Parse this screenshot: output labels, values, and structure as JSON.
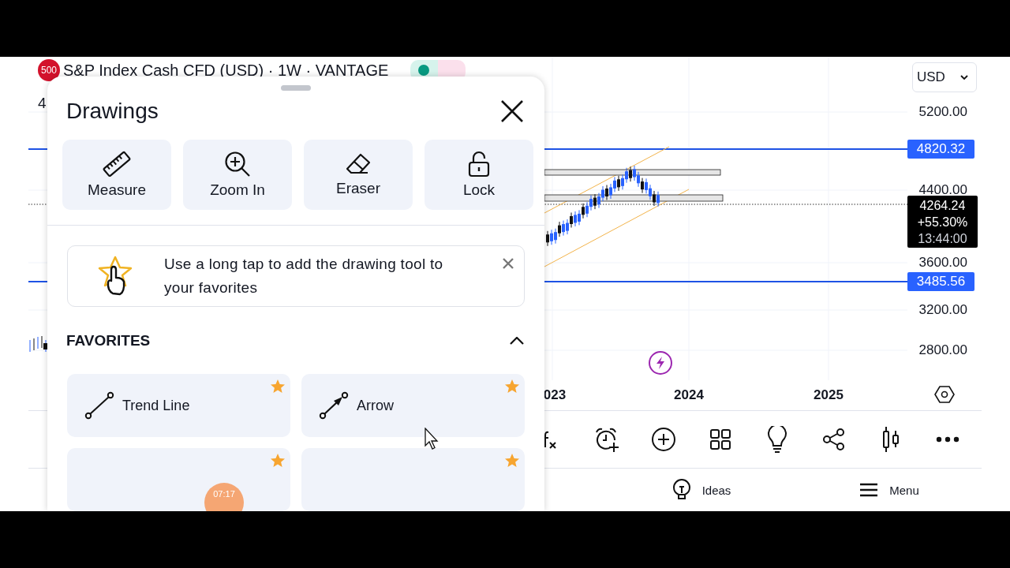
{
  "symbol": {
    "badge": "500",
    "title": "S&P Index Cash CFD (USD) · 1W · VANTAGE",
    "value_fragment": "4"
  },
  "currency_select": {
    "value": "USD"
  },
  "price_axis": {
    "ticks": [
      "5200.00",
      "4400.00",
      "3600.00",
      "3200.00",
      "2800.00"
    ]
  },
  "price_levels": [
    {
      "value": "4820.32"
    },
    {
      "value": "3485.56"
    }
  ],
  "last_price": {
    "price": "4264.24",
    "change": "+55.30%",
    "countdown": "13:44:00"
  },
  "time_axis": [
    "023",
    "2024",
    "2025"
  ],
  "bottom_nav": [
    {
      "kind": "ideas",
      "label": "Ideas"
    },
    {
      "kind": "menu",
      "label": "Menu"
    }
  ],
  "drawings_sheet": {
    "title": "Drawings",
    "tools": [
      {
        "kind": "measure",
        "label": "Measure"
      },
      {
        "kind": "zoom",
        "label": "Zoom In"
      },
      {
        "kind": "eraser",
        "label": "Eraser"
      },
      {
        "kind": "lock",
        "label": "Lock"
      }
    ],
    "tip": {
      "text": "Use a long tap to add the drawing tool to your favorites"
    },
    "favorites": {
      "title": "FAVORITES",
      "expanded": true,
      "items": [
        {
          "kind": "trend-line",
          "label": "Trend Line",
          "favorite": true
        },
        {
          "kind": "arrow",
          "label": "Arrow",
          "favorite": true
        },
        {
          "favorite": true
        },
        {
          "favorite": true
        }
      ]
    }
  },
  "recording_timer": "07:17"
}
